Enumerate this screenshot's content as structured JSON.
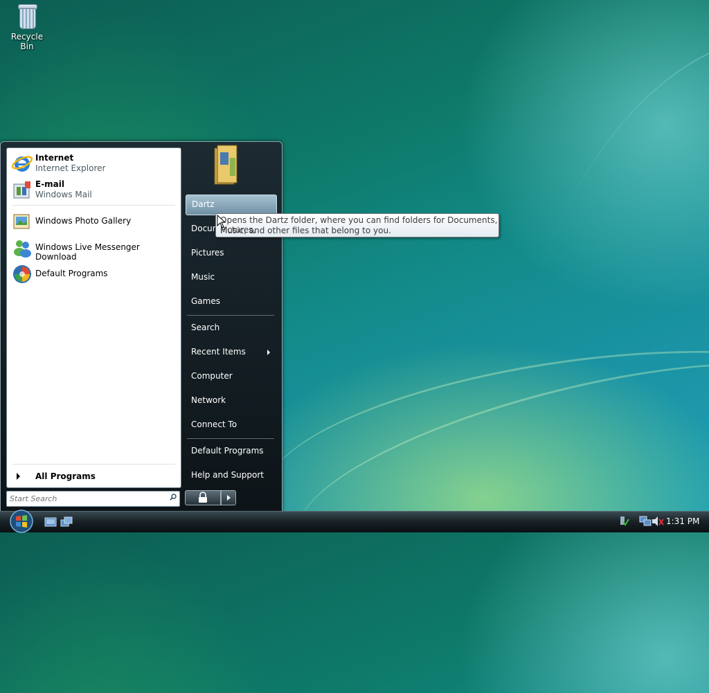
{
  "desktop": {
    "icons": [
      {
        "label": "Recycle Bin",
        "icon": "recycle-bin-icon"
      }
    ]
  },
  "start_menu": {
    "pinned": [
      {
        "title": "Internet",
        "subtitle": "Internet Explorer",
        "icon": "internet-explorer-icon"
      },
      {
        "title": "E-mail",
        "subtitle": "Windows Mail",
        "icon": "windows-mail-icon"
      }
    ],
    "recent": [
      {
        "label": "Windows Photo Gallery",
        "icon": "photo-gallery-icon"
      },
      {
        "label": "Windows Live Messenger Download",
        "icon": "messenger-icon"
      },
      {
        "label": "Default Programs",
        "icon": "default-programs-icon"
      }
    ],
    "all_programs": "All Programs",
    "search_placeholder": "Start Search",
    "right_items": {
      "dartz": "Dartz",
      "documents": "Documents",
      "pictures": "Pictures",
      "music": "Music",
      "games": "Games",
      "search": "Search",
      "recent_items": "Recent Items",
      "computer": "Computer",
      "network": "Network",
      "connect_to": "Connect To",
      "default_programs": "Default Programs",
      "help_and_support": "Help and Support"
    },
    "tooltip": {
      "line1": "Opens the Dartz folder, where you can find folders for Documents, Pictures,",
      "line2": "Music, and other files that belong to you."
    }
  },
  "taskbar": {
    "clock": "1:31 PM"
  }
}
